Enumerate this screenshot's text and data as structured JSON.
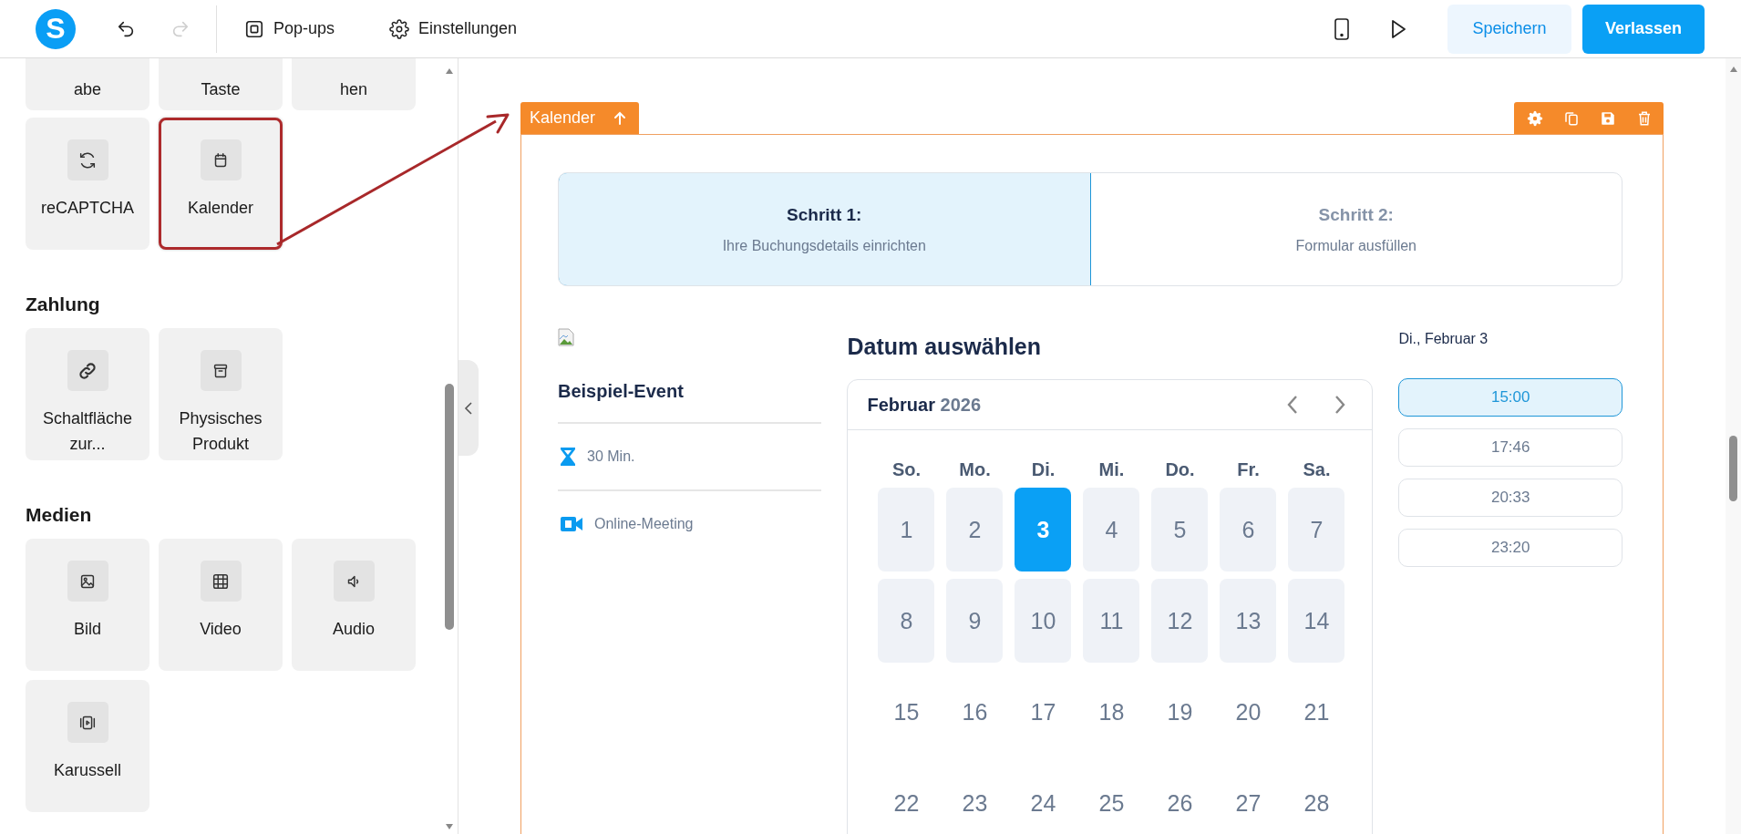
{
  "topbar": {
    "logo": "S",
    "history": [
      {
        "kind": "undo",
        "disabled": false
      },
      {
        "kind": "redo",
        "disabled": true
      }
    ],
    "nav": [
      {
        "label": "Pop-ups"
      },
      {
        "label": "Einstellungen"
      }
    ],
    "buttons": [
      {
        "label": "Speichern",
        "kind": "secondary"
      },
      {
        "label": "Verlassen",
        "kind": "primary"
      }
    ]
  },
  "sidebar": {
    "partial_tiles": [
      "abe",
      "Taste",
      "hen"
    ],
    "sections": [
      {
        "tiles": [
          {
            "label": "reCAPTCHA",
            "highlighted": false
          },
          {
            "label": "Kalender",
            "highlighted": true
          }
        ]
      },
      {
        "title": "Zahlung",
        "tiles": [
          {
            "label": "Schaltfläche zur...",
            "highlighted": false
          },
          {
            "label": "Physisches Produkt",
            "highlighted": false
          }
        ]
      },
      {
        "title": "Medien",
        "tiles": [
          {
            "label": "Bild",
            "highlighted": false
          },
          {
            "label": "Video",
            "highlighted": false
          },
          {
            "label": "Audio",
            "highlighted": false
          },
          {
            "label": "Karussell",
            "highlighted": false
          }
        ]
      }
    ]
  },
  "element": {
    "label": "Kalender",
    "steps": [
      {
        "title": "Schritt 1:",
        "subtitle": "Ihre Buchungsdetails einrichten",
        "selected": true
      },
      {
        "title": "Schritt 2:",
        "subtitle": "Formular ausfüllen",
        "selected": false
      }
    ],
    "event": {
      "name": "Beispiel-Event",
      "duration": "30 Min.",
      "location": "Online-Meeting"
    },
    "datepicker": {
      "heading": "Datum auswählen",
      "month": "Februar",
      "year": "2026",
      "weekdays": [
        "So.",
        "Mo.",
        "Di.",
        "Mi.",
        "Do.",
        "Fr.",
        "Sa."
      ],
      "days": [
        {
          "label": "1",
          "available": true,
          "selected": false
        },
        {
          "label": "2",
          "available": true,
          "selected": false
        },
        {
          "label": "3",
          "available": true,
          "selected": true
        },
        {
          "label": "4",
          "available": true,
          "selected": false
        },
        {
          "label": "5",
          "available": true,
          "selected": false
        },
        {
          "label": "6",
          "available": true,
          "selected": false
        },
        {
          "label": "7",
          "available": true,
          "selected": false
        },
        {
          "label": "8",
          "available": true,
          "selected": false
        },
        {
          "label": "9",
          "available": true,
          "selected": false
        },
        {
          "label": "10",
          "available": true,
          "selected": false
        },
        {
          "label": "11",
          "available": true,
          "selected": false
        },
        {
          "label": "12",
          "available": true,
          "selected": false
        },
        {
          "label": "13",
          "available": true,
          "selected": false
        },
        {
          "label": "14",
          "available": true,
          "selected": false
        },
        {
          "label": "15",
          "available": false,
          "selected": false
        },
        {
          "label": "16",
          "available": false,
          "selected": false
        },
        {
          "label": "17",
          "available": false,
          "selected": false
        },
        {
          "label": "18",
          "available": false,
          "selected": false
        },
        {
          "label": "19",
          "available": false,
          "selected": false
        },
        {
          "label": "20",
          "available": false,
          "selected": false
        },
        {
          "label": "21",
          "available": false,
          "selected": false
        },
        {
          "label": "22",
          "available": false,
          "selected": false
        },
        {
          "label": "23",
          "available": false,
          "selected": false
        },
        {
          "label": "24",
          "available": false,
          "selected": false
        },
        {
          "label": "25",
          "available": false,
          "selected": false
        },
        {
          "label": "26",
          "available": false,
          "selected": false
        },
        {
          "label": "27",
          "available": false,
          "selected": false
        },
        {
          "label": "28",
          "available": false,
          "selected": false
        }
      ]
    },
    "times": {
      "date_label": "Di., Februar 3",
      "slots": [
        {
          "label": "15:00",
          "selected": true
        },
        {
          "label": "17:46",
          "selected": false
        },
        {
          "label": "20:33",
          "selected": false
        },
        {
          "label": "23:20",
          "selected": false
        }
      ]
    }
  }
}
